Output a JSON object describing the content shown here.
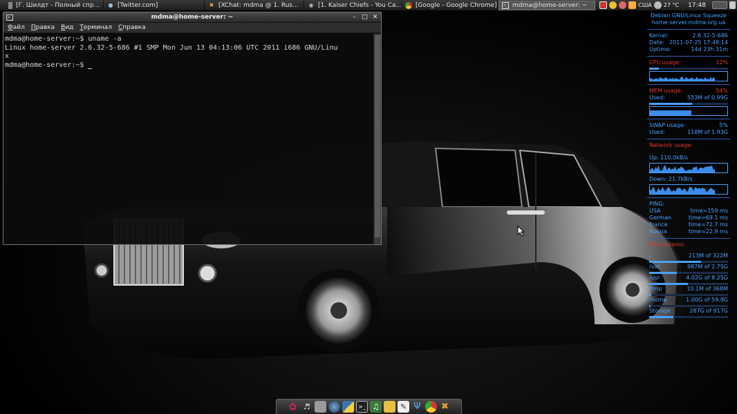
{
  "taskbar": {
    "tasks": [
      {
        "label": "[Г. Шилдт - Полный спр...",
        "icon": "book-icon"
      },
      {
        "label": "[Twitter.com]",
        "icon": "chat-bubble-icon"
      },
      {
        "label": "[XChat: mdma @ 1. Rus...",
        "icon": "xchat-icon"
      },
      {
        "label": "[1. Kaiser Chiefs - You Ca...",
        "icon": "media-player-icon"
      },
      {
        "label": "[Google - Google Chrome]",
        "icon": "chrome-icon"
      },
      {
        "label": "mdma@home-server: ~",
        "icon": "terminal-icon",
        "active": true
      }
    ],
    "tray": {
      "layout": "США",
      "temperature": "27 °C",
      "clock": "17:48"
    }
  },
  "terminal": {
    "title": "mdma@home-server: ~",
    "menu": [
      {
        "underline": "Ф",
        "rest": "айл"
      },
      {
        "underline": "П",
        "rest": "равка"
      },
      {
        "underline": "В",
        "rest": "ид"
      },
      {
        "underline": "Т",
        "rest": "ерминал"
      },
      {
        "underline": "С",
        "rest": "правка"
      }
    ],
    "lines": [
      "mdma@home-server:~$ uname -a",
      "Linux home-server 2.6.32-5-686 #1 SMP Mon Jun 13 04:13:06 UTC 2011 i686 GNU/Linu",
      "x",
      "mdma@home-server:~$ "
    ]
  },
  "conky": {
    "os": "Debian GNU/Linux Squeeze",
    "host": "home-server.mdma.org.ua",
    "kernel_label": "Kernel:",
    "kernel": "2.6.32-5-686",
    "date_label": "Date:",
    "date": "2011-07-25 17:48:14",
    "uptime_label": "Uptime:",
    "uptime": "14d 23h 31m",
    "cpu_label": "CPU usage:",
    "cpu_value": "12%",
    "cpu_fraction": 0.12,
    "mem_label": "MEM usage:",
    "mem_value": "54%",
    "mem_fraction": 0.54,
    "mem_used_label": "Used:",
    "mem_used": "553M of 0.99G",
    "swap_label": "SWAP usage:",
    "swap_value": "5%",
    "swap_fraction": 0.05,
    "swap_used_label": "Used:",
    "swap_used": "118M of 1.93G",
    "net_label": "Network usage:",
    "up_label": "Up: 110.0kB/s",
    "down_label": "Down: 21.7kB/s",
    "ping_label": "PING:",
    "ping": [
      {
        "name": "USA",
        "time": "time=159 ms"
      },
      {
        "name": "German",
        "time": "time=69.1 ms"
      },
      {
        "name": "France",
        "time": "time=72.7 ms"
      },
      {
        "name": "Russia",
        "time": "time=22.9 ms"
      }
    ],
    "fs_label": "File systems:",
    "filesystems": [
      {
        "name": "/",
        "value": "213M of 322M",
        "fraction": 0.66
      },
      {
        "name": "/var",
        "value": "987M of 2.75G",
        "fraction": 0.35
      },
      {
        "name": "/usr",
        "value": "4.02G of 8.25G",
        "fraction": 0.49
      },
      {
        "name": "/tmp",
        "value": "10.1M of 368M",
        "fraction": 0.03
      },
      {
        "name": "/home",
        "value": "1.00G of 59.8G",
        "fraction": 0.02
      },
      {
        "name": "Storage",
        "value": "287G of 917G",
        "fraction": 0.31
      }
    ]
  },
  "dock": {
    "items": [
      "debian-swirl-icon",
      "volume-icon",
      "drive-icon",
      "browser-globe-icon",
      "python-icon",
      "terminal-icon",
      "music-icon",
      "folder-icon",
      "text-editor-icon",
      "usb-icon",
      "chrome-icon",
      "xchat-icon"
    ]
  },
  "colors": {
    "accent": "#4aa0ff",
    "alert": "#e23a2a"
  }
}
